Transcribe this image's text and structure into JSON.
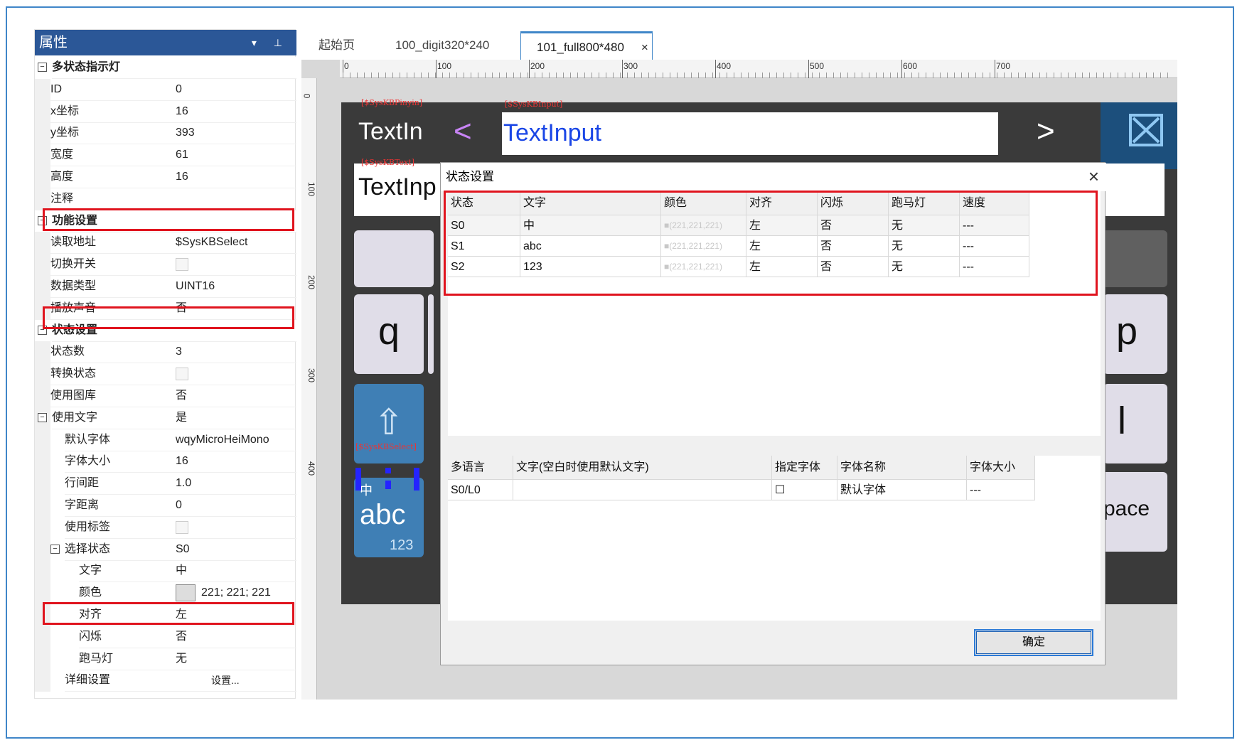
{
  "properties_panel": {
    "title": "属性",
    "header_controls": "▾ ⊥",
    "rows": [
      {
        "type": "cat",
        "label": "多状态指示灯"
      },
      {
        "type": "prop",
        "label": "ID",
        "value": "0"
      },
      {
        "type": "prop",
        "label": "x坐标",
        "value": "16"
      },
      {
        "type": "prop",
        "label": "y坐标",
        "value": "393"
      },
      {
        "type": "prop",
        "label": "宽度",
        "value": "61"
      },
      {
        "type": "prop",
        "label": "高度",
        "value": "16"
      },
      {
        "type": "prop",
        "label": "注释",
        "value": ""
      },
      {
        "type": "cat",
        "label": "功能设置"
      },
      {
        "type": "prop",
        "label": "读取地址",
        "value": "$SysKBSelect"
      },
      {
        "type": "check",
        "label": "切换开关",
        "value": ""
      },
      {
        "type": "prop",
        "label": "数据类型",
        "value": "UINT16"
      },
      {
        "type": "prop",
        "label": "播放声音",
        "value": "否"
      },
      {
        "type": "cat",
        "label": "状态设置"
      },
      {
        "type": "prop",
        "label": "状态数",
        "value": "3"
      },
      {
        "type": "check",
        "label": "转换状态",
        "value": ""
      },
      {
        "type": "prop",
        "label": "使用图库",
        "value": "否"
      },
      {
        "type": "subcat",
        "label": "使用文字",
        "value": "是"
      },
      {
        "type": "prop1",
        "label": "默认字体",
        "value": "wqyMicroHeiMono"
      },
      {
        "type": "prop1",
        "label": "字体大小",
        "value": "16"
      },
      {
        "type": "prop1",
        "label": "行间距",
        "value": "1.0"
      },
      {
        "type": "prop1",
        "label": "字距离",
        "value": "0"
      },
      {
        "type": "check1",
        "label": "使用标签",
        "value": ""
      },
      {
        "type": "subcat1",
        "label": "选择状态",
        "value": "S0"
      },
      {
        "type": "prop2",
        "label": "文字",
        "value": "中"
      },
      {
        "type": "color2",
        "label": "颜色",
        "value": "221; 221; 221"
      },
      {
        "type": "prop2",
        "label": "对齐",
        "value": "左"
      },
      {
        "type": "prop2",
        "label": "闪烁",
        "value": "否"
      },
      {
        "type": "prop2",
        "label": "跑马灯",
        "value": "无"
      },
      {
        "type": "btn1",
        "label": "详细设置",
        "value": "设置..."
      }
    ]
  },
  "tabs": [
    {
      "label": "起始页"
    },
    {
      "label": "100_digit320*240"
    },
    {
      "label": "101_full800*480",
      "close": "×"
    }
  ],
  "ruler": {
    "h": [
      "0",
      "100",
      "200",
      "300",
      "400",
      "500",
      "600",
      "700"
    ],
    "v": [
      "0",
      "100",
      "200",
      "300",
      "400"
    ]
  },
  "device": {
    "top_label": "TextIn",
    "arrow_left": "<",
    "input_text": "TextInput",
    "arrow_right": ">",
    "second_label": "TextInp",
    "tag_pinyin": "[$SysKBPinyin]",
    "tag_input": "[$SysKBInput]",
    "tag_text": "[$SysKBText]",
    "tag_select": "[$SysKBSelect]",
    "key_q": "q",
    "key_p": "p",
    "key_l": "l",
    "key_space": "pace",
    "shift_glyph": "⇧",
    "mode_small": "中",
    "mode_main": "abc",
    "mode_num": "123"
  },
  "dialog": {
    "title": "状态设置",
    "close": "×",
    "state_headers": [
      "状态",
      "文字",
      "颜色",
      "对齐",
      "闪烁",
      "跑马灯",
      "速度"
    ],
    "state_rows": [
      [
        "S0",
        "中",
        "■(221,221,221)",
        "左",
        "否",
        "无",
        "---"
      ],
      [
        "S1",
        "abc",
        "■(221,221,221)",
        "左",
        "否",
        "无",
        "---"
      ],
      [
        "S2",
        "123",
        "■(221,221,221)",
        "左",
        "否",
        "无",
        "---"
      ]
    ],
    "lang_headers": [
      "多语言",
      "文字(空白时使用默认文字)",
      "指定字体",
      "字体名称",
      "字体大小"
    ],
    "lang_rows": [
      [
        "S0/L0",
        "",
        "☐",
        "默认字体",
        "---"
      ]
    ],
    "ok": "确定"
  },
  "colors": {
    "accent": "#2b5797",
    "highlight": "#e0141e",
    "frame": "#3f86c8"
  }
}
